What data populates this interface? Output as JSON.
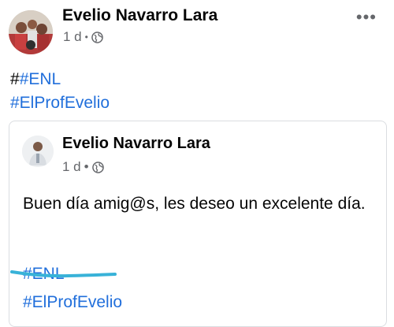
{
  "post": {
    "author": "Evelio Navarro Lara",
    "time": "1 d",
    "separator": "•",
    "privacy_icon": "globe-icon",
    "more_label": "•••",
    "text_prefix": "#",
    "hashtags": [
      "#ENL",
      "#ElProfEvelio"
    ]
  },
  "shared_post": {
    "author": "Evelio Navarro Lara",
    "time": "1 d",
    "separator": "•",
    "privacy_icon": "globe-icon",
    "body": "Buen día amig@s, les deseo un excelente día.",
    "hashtags": [
      "#ENL",
      "#ElProfEvelio"
    ]
  },
  "colors": {
    "hashtag": "#216fdb",
    "meta_gray": "#65676b",
    "underline": "#38b2d8"
  }
}
